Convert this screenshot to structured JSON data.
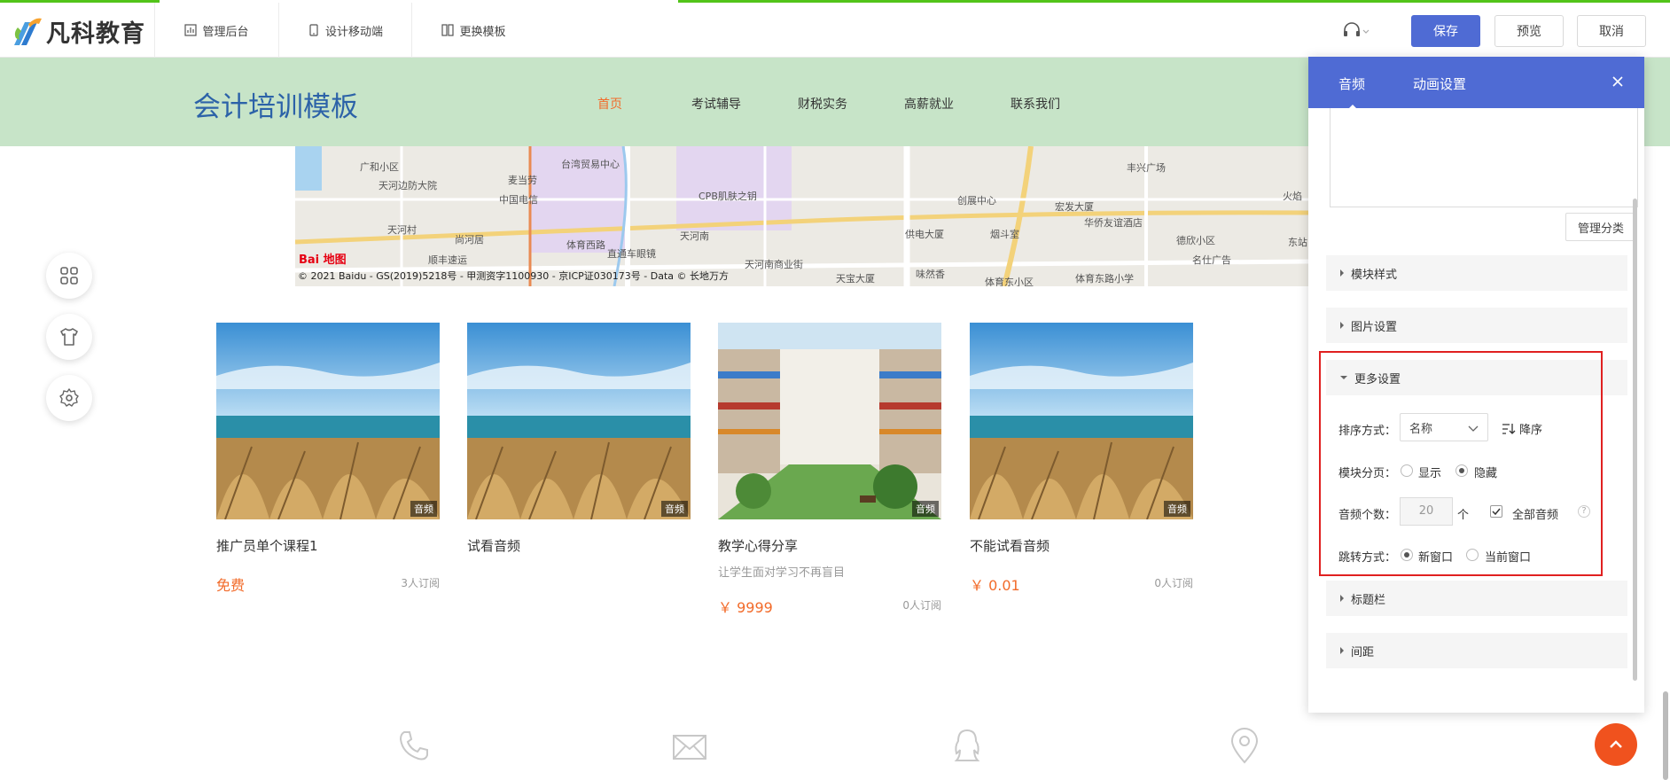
{
  "editor": {
    "logo_text": "凡科教育",
    "tools": [
      {
        "label": "管理后台",
        "icon": "dashboard-icon"
      },
      {
        "label": "设计移动端",
        "icon": "mobile-icon"
      },
      {
        "label": "更换模板",
        "icon": "template-icon"
      }
    ],
    "buttons": {
      "save": "保存",
      "preview": "预览",
      "cancel": "取消"
    },
    "accent_color": "#4f6bd4"
  },
  "site": {
    "title": "会计培训模板",
    "nav": [
      "首页",
      "考试辅导",
      "财税实务",
      "高薪就业",
      "联系我们"
    ],
    "active_nav": "首页",
    "header_bg": "#c7e4c8"
  },
  "map": {
    "logo": "Bai 地图",
    "credit": "© 2021 Baidu - GS(2019)5218号 - 甲测资字1100930 - 京ICP证030173号 - Data © 长地万方",
    "labels": [
      "广和小区",
      "天河边防大院",
      "麦当劳",
      "台湾贸易中心",
      "中国电信",
      "CPB肌肤之钥",
      "天河村",
      "尚河居",
      "体育西路",
      "直通车眼镜",
      "天河南",
      "天河南商业街",
      "供电大厦",
      "烟斗室",
      "创展中心",
      "宏发大厦",
      "华侨友谊酒店",
      "丰兴广场",
      "德欣小区",
      "名仕广告",
      "体育东小区",
      "体育东路小学",
      "天宝大厦",
      "味然香",
      "顺丰速运",
      "火焰",
      "东站"
    ]
  },
  "cards": [
    {
      "title": "推广员单个课程1",
      "subtitle": "",
      "price": "免费",
      "subscribers": "3人订阅",
      "badge": "音频",
      "image": "beach-grass"
    },
    {
      "title": "试看音频",
      "subtitle": "",
      "price": "",
      "subscribers": "",
      "badge": "音频",
      "image": "beach-grass"
    },
    {
      "title": "教学心得分享",
      "subtitle": "让学生面对学习不再盲目",
      "price": "￥ 9999",
      "subscribers": "0人订阅",
      "badge": "音频",
      "image": "atrium-building"
    },
    {
      "title": "不能试看音频",
      "subtitle": "",
      "price": "￥ 0.01",
      "subscribers": "0人订阅",
      "badge": "音频",
      "image": "beach-grass"
    }
  ],
  "float_tools": [
    "apps-icon",
    "shirt-icon",
    "gear-icon"
  ],
  "footer_icons": [
    "phone-icon",
    "mail-icon",
    "qq-icon",
    "location-icon"
  ],
  "panel": {
    "tabs": [
      "音频",
      "动画设置"
    ],
    "active_tab": "音频",
    "manage_category": "管理分类",
    "sections": {
      "module_style": "模块样式",
      "image_settings": "图片设置",
      "more_settings": "更多设置",
      "title_bar": "标题栏",
      "spacing": "间距"
    },
    "sort": {
      "label": "排序方式：",
      "value": "名称",
      "order_label": "降序"
    },
    "paging": {
      "label": "模块分页：",
      "options": [
        "显示",
        "隐藏"
      ],
      "selected": "隐藏"
    },
    "count": {
      "label": "音频个数：",
      "value": "20",
      "unit": "个",
      "all_label": "全部音频",
      "all_checked": true,
      "help": "?"
    },
    "jump": {
      "label": "跳转方式：",
      "options": [
        "新窗口",
        "当前窗口"
      ],
      "selected": "新窗口"
    }
  }
}
